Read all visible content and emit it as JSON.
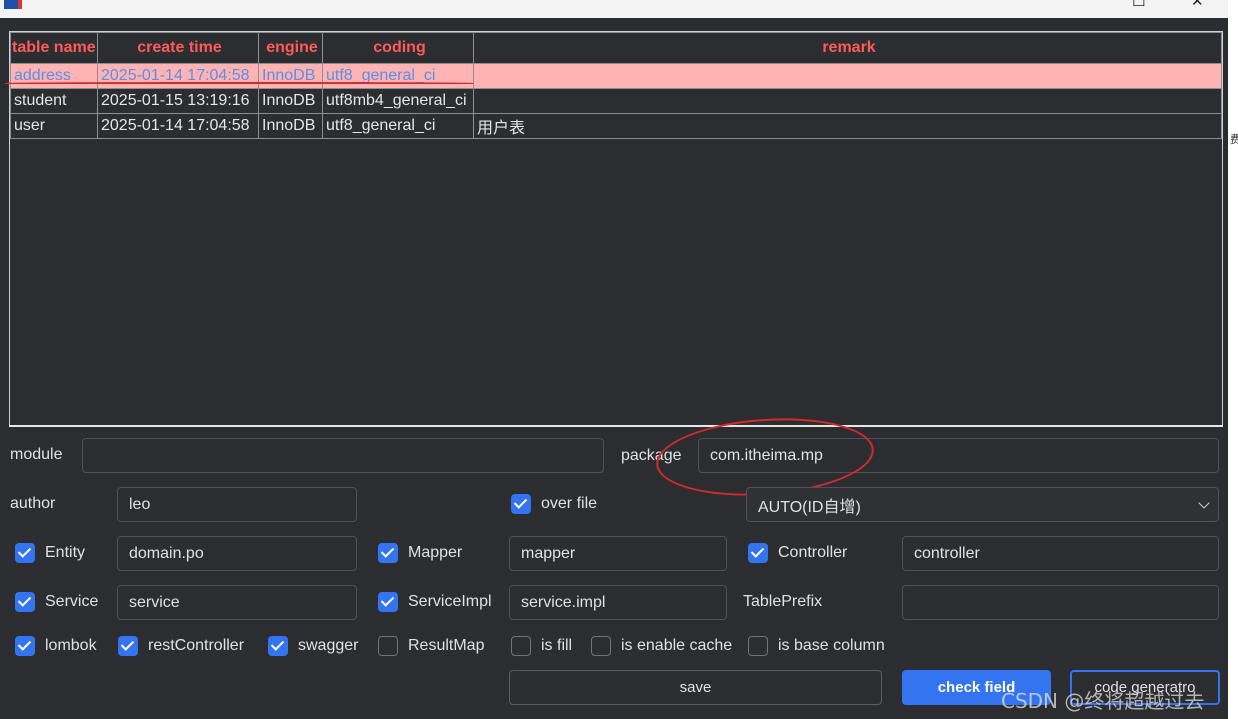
{
  "titlebar": {
    "maximize_glyph": "☐",
    "close_glyph": "✕"
  },
  "table": {
    "columns": [
      "table name",
      "create time",
      "engine",
      "coding",
      "remark"
    ],
    "rows": [
      [
        "address",
        "2025-01-14 17:04:58",
        "InnoDB",
        "utf8_general_ci",
        ""
      ],
      [
        "student",
        "2025-01-15 13:19:16",
        "InnoDB",
        "utf8mb4_general_ci",
        ""
      ],
      [
        "user",
        "2025-01-14 17:04:58",
        "InnoDB",
        "utf8_general_ci",
        "用户表"
      ]
    ],
    "selected_row": 0
  },
  "form": {
    "module": {
      "label": "module",
      "value": ""
    },
    "package": {
      "label": "package",
      "value": "com.itheima.mp"
    },
    "author": {
      "label": "author",
      "value": "leo"
    },
    "over_file": {
      "label": "over file",
      "checked": true
    },
    "id_type": {
      "selected": "AUTO(ID自增)"
    },
    "entity": {
      "label": "Entity",
      "checked": true,
      "value": "domain.po"
    },
    "mapper": {
      "label": "Mapper",
      "checked": true,
      "value": "mapper"
    },
    "controller": {
      "label": "Controller",
      "checked": true,
      "value": "controller"
    },
    "service": {
      "label": "Service",
      "checked": true,
      "value": "service"
    },
    "service_impl": {
      "label": "ServiceImpl",
      "checked": true,
      "value": "service.impl"
    },
    "table_prefix": {
      "label": "TablePrefix",
      "value": ""
    },
    "options": [
      {
        "label": "lombok",
        "checked": true
      },
      {
        "label": "restController",
        "checked": true
      },
      {
        "label": "swagger",
        "checked": true
      },
      {
        "label": "ResultMap",
        "checked": false
      },
      {
        "label": "is fill",
        "checked": false
      },
      {
        "label": "is enable cache",
        "checked": false
      },
      {
        "label": "is base column",
        "checked": false
      }
    ]
  },
  "buttons": {
    "save": "save",
    "check_field": "check field",
    "code_generator": "code generatro"
  },
  "watermark": "CSDN @终将超越过去",
  "right_edge_glyph": "费",
  "colors": {
    "background": "#2b2d30",
    "header_text": "#ff5a5a",
    "selected_row": "#ffb3b3",
    "accent": "#3574f0",
    "annotation": "#d42a2a"
  },
  "icons": [
    "app-icon",
    "maximize-icon",
    "close-icon",
    "chevron-down-icon",
    "checkbox-icon"
  ]
}
